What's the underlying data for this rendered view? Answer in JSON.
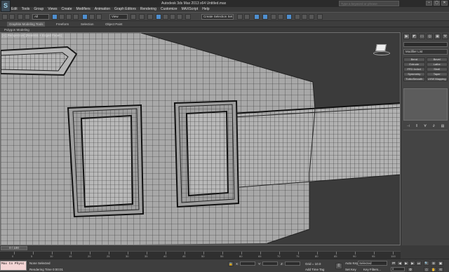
{
  "window": {
    "title": "Autodesk 3ds Max 2013 x64     Untitled.max",
    "app_logo": "S",
    "search_placeholder": "Type a keyword or phrase",
    "buttons": [
      "–",
      "▢",
      "✕"
    ]
  },
  "menu": [
    "Edit",
    "Tools",
    "Group",
    "Views",
    "Create",
    "Modifiers",
    "Animation",
    "Graph Editors",
    "Rendering",
    "Customize",
    "MAXScript",
    "Help"
  ],
  "toolbar": {
    "selection_filter": "All",
    "ref_coord": "View",
    "named_selection": "Create Selection Set"
  },
  "ribbon": {
    "tabs": [
      "Graphite Modeling Tools",
      "Freeform",
      "Selection",
      "Object Paint"
    ],
    "active_tab": 0,
    "panel_label": "Polygon Modeling"
  },
  "viewport": {
    "label": "[+] [Perspective] [Realistic + Edged Faces]"
  },
  "command_panel": {
    "tab_icons": [
      "▶",
      "◩",
      "▭",
      "◎",
      "▣",
      "⚒"
    ],
    "modifier_list": "Modifier List",
    "modifiers": [
      "Bend",
      "Bevel",
      "Extrude",
      "Lathe",
      "FFD 4x4x4",
      "Shell",
      "Symmetry",
      "Taper",
      "TurboSmooth",
      "UVW Mapping"
    ],
    "stack_tools": [
      "⊣",
      "‖",
      "∀",
      "∂",
      "▤"
    ]
  },
  "timeline": {
    "frame_label": "0 / 100",
    "ticks": [
      "0",
      "5",
      "10",
      "15",
      "20",
      "25",
      "30",
      "35",
      "40",
      "45",
      "50",
      "55",
      "60",
      "65",
      "70",
      "75",
      "80",
      "85",
      "90",
      "95",
      "100"
    ]
  },
  "status": {
    "listener_text": "Max to Physc",
    "selection": "None Selected",
    "render_time": "Rendering Time  0:00:01",
    "x_label": "X:",
    "y_label": "Y:",
    "z_label": "Z:",
    "grid": "Grid = 10.0",
    "add_time_tag": "Add Time Tag",
    "auto_key": "Auto Key",
    "set_key": "Set Key",
    "key_mode": "Selected",
    "key_filters": "Key Filters...",
    "frame_field": "0"
  },
  "colors": {
    "viewport_bg": "#5a5a5a",
    "ui_panel": "#444444",
    "accent": "#4f8fcf",
    "listener_bg": "#f4d6d6"
  }
}
